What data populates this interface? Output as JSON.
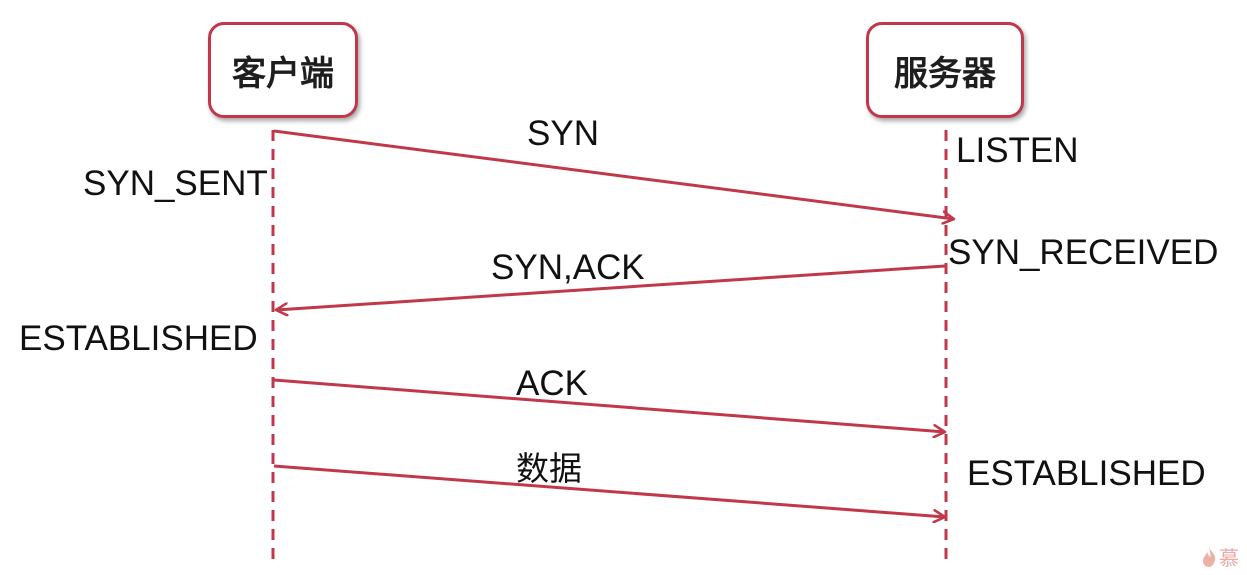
{
  "participants": {
    "client": "客户端",
    "server": "服务器"
  },
  "messages": [
    {
      "label": "SYN",
      "from": "client",
      "to": "server"
    },
    {
      "label": "SYN,ACK",
      "from": "server",
      "to": "client"
    },
    {
      "label": "ACK",
      "from": "client",
      "to": "server"
    },
    {
      "label": "数据",
      "from": "client",
      "to": "server"
    }
  ],
  "states": {
    "client_syn_sent": "SYN_SENT",
    "client_established": "ESTABLISHED",
    "server_listen": "LISTEN",
    "server_syn_received": "SYN_RECEIVED",
    "server_established": "ESTABLISHED"
  },
  "watermark": {
    "text": "慕"
  },
  "colors": {
    "accent": "#c0384a",
    "text": "#111111"
  }
}
